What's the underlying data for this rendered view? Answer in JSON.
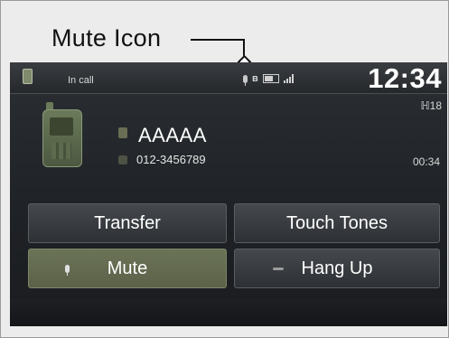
{
  "callout": {
    "label": "Mute Icon"
  },
  "status_bar": {
    "status_text": "In call",
    "clock": "12:34",
    "bluetooth_glyph": "ʙ",
    "icons": [
      "phone-icon",
      "mute-mic-icon",
      "bluetooth-icon",
      "battery-icon",
      "signal-icon"
    ]
  },
  "call": {
    "contact_name": "AAAAA",
    "contact_number": "012-3456789",
    "signal_text": "ℍ18",
    "duration": "00:34"
  },
  "buttons": {
    "transfer": "Transfer",
    "touch_tones": "Touch Tones",
    "mute": "Mute",
    "hang_up": "Hang Up"
  },
  "colors": {
    "screen_background": "#1f2226",
    "active_button": "#6b7357",
    "button": "#3a3e42",
    "text": "#ffffff"
  }
}
